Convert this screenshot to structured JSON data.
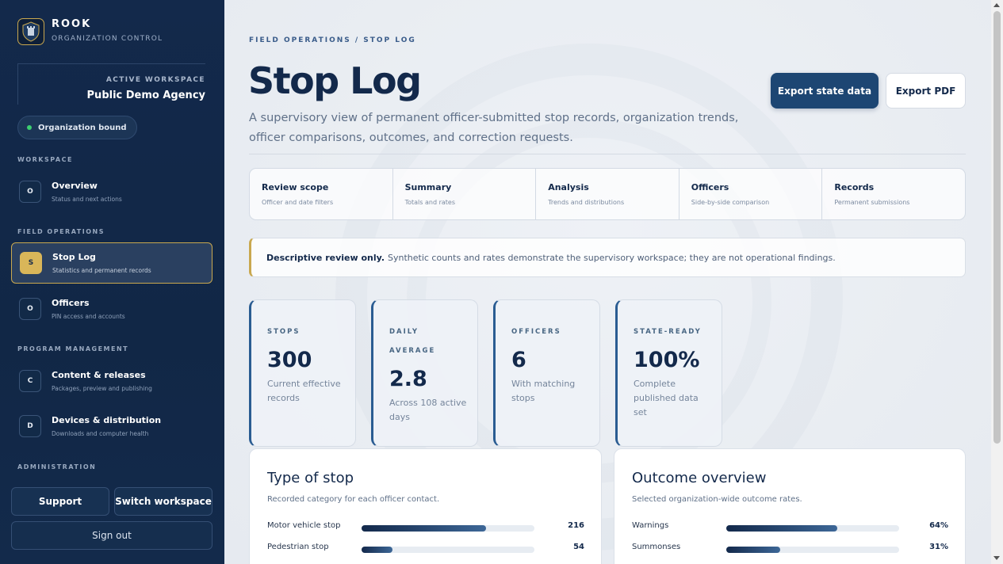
{
  "brand": {
    "name": "ROOK",
    "subtitle": "ORGANIZATION CONTROL",
    "logo_icon": "rook-shield-logo"
  },
  "workspace": {
    "label": "ACTIVE WORKSPACE",
    "name": "Public Demo Agency",
    "status": "Organization bound",
    "status_color": "#3ccf70"
  },
  "sidebar": {
    "sections": {
      "workspace": "WORKSPACE",
      "field_operations": "FIELD OPERATIONS",
      "program_management": "PROGRAM MANAGEMENT",
      "administration": "ADMINISTRATION"
    },
    "items": [
      {
        "badge": "O",
        "title": "Overview",
        "subtitle": "Status and next actions"
      },
      {
        "badge": "S",
        "title": "Stop Log",
        "subtitle": "Statistics and permanent records",
        "active": true
      },
      {
        "badge": "O",
        "title": "Officers",
        "subtitle": "PIN access and accounts"
      },
      {
        "badge": "C",
        "title": "Content & releases",
        "subtitle": "Packages, preview and publishing"
      },
      {
        "badge": "D",
        "title": "Devices & distribution",
        "subtitle": "Downloads and computer health"
      }
    ],
    "buttons": {
      "support": "Support",
      "switch_workspace": "Switch workspace",
      "sign_out": "Sign out"
    }
  },
  "header": {
    "breadcrumb": "FIELD OPERATIONS / STOP LOG",
    "title": "Stop Log",
    "description": "A supervisory view of permanent officer-submitted stop records, organization trends, officer comparisons, outcomes, and correction requests.",
    "export_state": "Export state data",
    "export_pdf": "Export PDF"
  },
  "tabs": [
    {
      "title": "Review scope",
      "subtitle": "Officer and date filters"
    },
    {
      "title": "Summary",
      "subtitle": "Totals and rates"
    },
    {
      "title": "Analysis",
      "subtitle": "Trends and distributions"
    },
    {
      "title": "Officers",
      "subtitle": "Side-by-side comparison"
    },
    {
      "title": "Records",
      "subtitle": "Permanent submissions"
    }
  ],
  "notice": {
    "bold": "Descriptive review only.",
    "text": "Synthetic counts and rates demonstrate the supervisory workspace; they are not operational findings.",
    "accent": "#c9a84f"
  },
  "stats": [
    {
      "label": "STOPS",
      "value": "300",
      "desc": "Current effective records"
    },
    {
      "label": "DAILY AVERAGE",
      "value": "2.8",
      "desc": "Across 108 active days"
    },
    {
      "label": "OFFICERS",
      "value": "6",
      "desc": "With matching stops"
    },
    {
      "label": "STATE-READY",
      "value": "100%",
      "desc": "Complete published data set"
    }
  ],
  "type_of_stop": {
    "title": "Type of stop",
    "subtitle": "Recorded category for each officer contact.",
    "rows": [
      {
        "label": "Motor vehicle stop",
        "value": "216",
        "fraction": 0.72
      },
      {
        "label": "Pedestrian stop",
        "value": "54",
        "fraction": 0.18
      }
    ]
  },
  "outcome_overview": {
    "title": "Outcome overview",
    "subtitle": "Selected organization-wide outcome rates.",
    "rows": [
      {
        "label": "Warnings",
        "value": "64%",
        "fraction": 0.64
      },
      {
        "label": "Summonses",
        "value": "31%",
        "fraction": 0.31
      }
    ]
  },
  "colors": {
    "navy": "#13294b",
    "accent_gold": "#c9a84f",
    "primary_button": "#1d4673"
  }
}
